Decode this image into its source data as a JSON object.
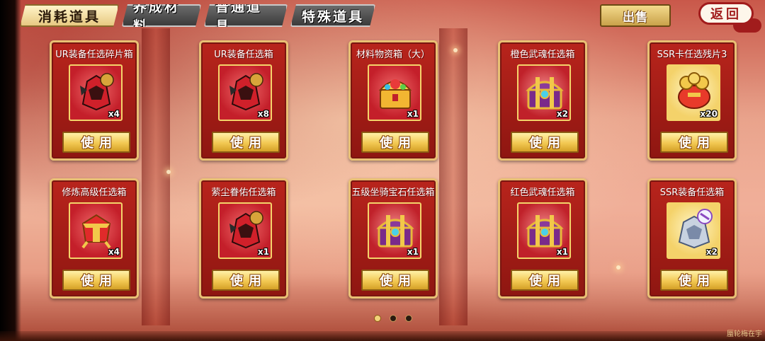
{
  "tabs": [
    {
      "label": "消耗道具",
      "active": true
    },
    {
      "label": "养成材料",
      "active": false
    },
    {
      "label": "普通道具",
      "active": false
    },
    {
      "label": "特殊道具",
      "active": false
    }
  ],
  "header": {
    "sell_label": "出售",
    "back_label": "返回"
  },
  "use_label": "使用",
  "items": [
    {
      "name": "UR装备任选碎片箱",
      "count": "x4",
      "icon": "red-armor-icon"
    },
    {
      "name": "UR装备任选箱",
      "count": "x8",
      "icon": "red-armor-icon"
    },
    {
      "name": "材料物资箱（大）",
      "count": "x1",
      "icon": "gold-treasure-chest-icon"
    },
    {
      "name": "橙色武魂任选箱",
      "count": "x2",
      "icon": "purple-gold-chest-icon"
    },
    {
      "name": "SSR卡任选残片3",
      "count": "x20",
      "icon": "gold-coin-pouch-icon"
    },
    {
      "name": "修炼高级任选箱",
      "count": "x4",
      "icon": "red-gold-box-icon"
    },
    {
      "name": "萦尘眷佑任选箱",
      "count": "x1",
      "icon": "red-armor-icon"
    },
    {
      "name": "五级坐骑宝石任选箱",
      "count": "x1",
      "icon": "purple-gold-chest-icon"
    },
    {
      "name": "红色武魂任选箱",
      "count": "x1",
      "icon": "purple-gold-chest-icon"
    },
    {
      "name": "SSR装备任选箱",
      "count": "x2",
      "icon": "silver-armor-legend-icon"
    }
  ],
  "pager": {
    "pages": 3,
    "current": 1
  },
  "footer_text": "蜃轮梅在宇",
  "colors": {
    "card_red": "#b8241c",
    "card_border_gold": "#e9c074",
    "button_gold": "#f2c852",
    "back_red": "#a11c1c"
  }
}
